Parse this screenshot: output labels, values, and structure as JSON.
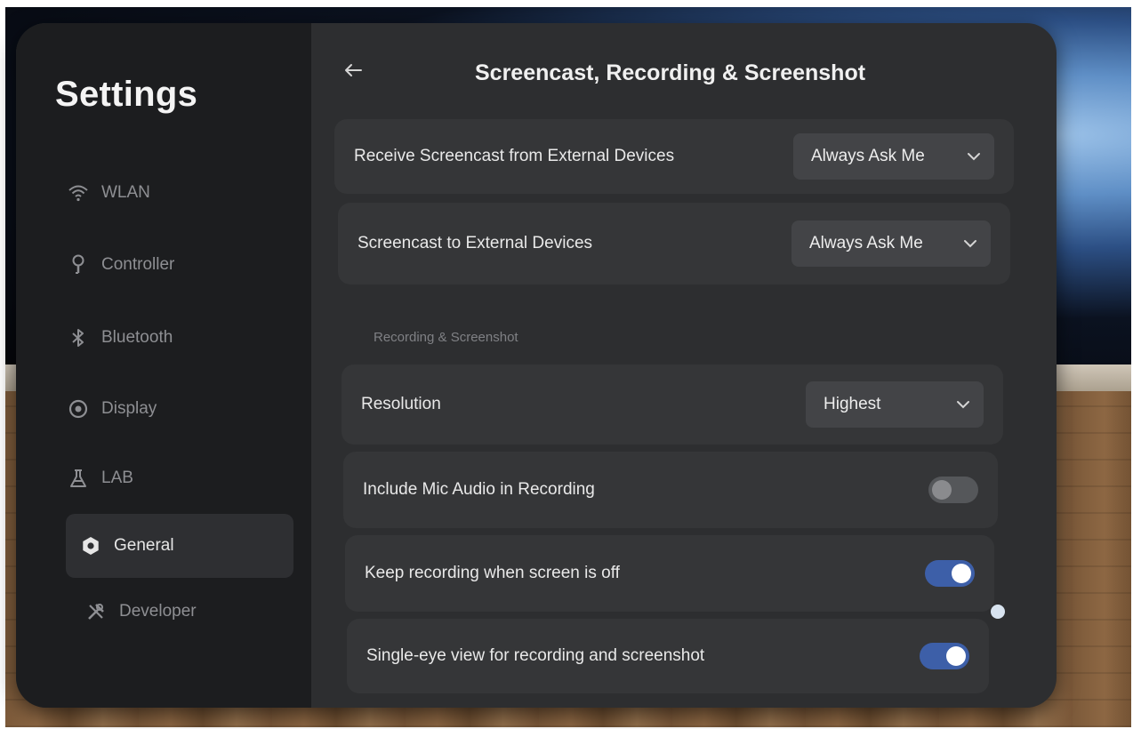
{
  "sidebar": {
    "title": "Settings",
    "items": [
      {
        "label": "WLAN",
        "icon": "wifi-icon"
      },
      {
        "label": "Controller",
        "icon": "controller-icon"
      },
      {
        "label": "Bluetooth",
        "icon": "bluetooth-icon"
      },
      {
        "label": "Display",
        "icon": "eye-icon"
      },
      {
        "label": "LAB",
        "icon": "flask-icon"
      },
      {
        "label": "General",
        "icon": "gear-icon",
        "active": true
      },
      {
        "label": "Developer",
        "icon": "tools-icon"
      }
    ]
  },
  "header": {
    "title": "Screencast, Recording & Screenshot",
    "back_icon": "arrow-left-icon"
  },
  "settings": {
    "receive_screencast": {
      "label": "Receive Screencast from External Devices",
      "value": "Always Ask Me"
    },
    "screencast_to": {
      "label": "Screencast to External Devices",
      "value": "Always Ask Me"
    },
    "section_label": "Recording & Screenshot",
    "resolution": {
      "label": "Resolution",
      "value": "Highest"
    },
    "mic_audio": {
      "label": "Include Mic Audio in Recording",
      "enabled": false
    },
    "keep_recording": {
      "label": "Keep recording when screen is off",
      "enabled": true
    },
    "single_eye": {
      "label": "Single-eye view for recording and screenshot",
      "enabled": true
    }
  },
  "colors": {
    "accent": "#3d5fa8",
    "panel": "#2d2e30",
    "sidebar": "#1c1d1f"
  }
}
